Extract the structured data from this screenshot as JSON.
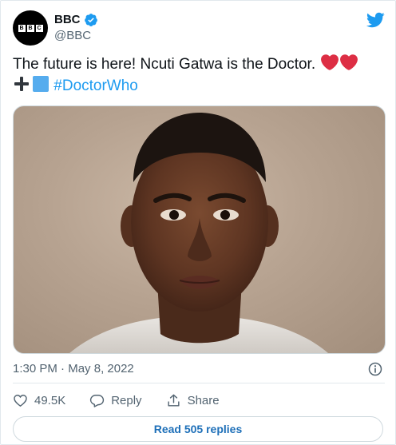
{
  "author": {
    "display_name": "BBC",
    "handle": "@BBC",
    "logo_letters": [
      "B",
      "B",
      "C"
    ],
    "verified": true
  },
  "tweet": {
    "text": "The future is here! Ncuti Gatwa is the Doctor.",
    "hashtag": "#DoctorWho",
    "emojis": [
      "red-heart",
      "red-heart",
      "plus-sign",
      "blue-square"
    ]
  },
  "photo": {
    "alt": "Portrait of Ncuti Gatwa"
  },
  "meta": {
    "time": "1:30 PM",
    "separator": "·",
    "date": "May 8, 2022"
  },
  "actions": {
    "likes": "49.5K",
    "reply_label": "Reply",
    "share_label": "Share"
  },
  "read_replies_label": "Read 505 replies",
  "colors": {
    "twitter_blue": "#1d9bf0",
    "heart_red": "#dd2e44",
    "link_blue": "#1d6fb8",
    "secondary_text": "#536471"
  }
}
